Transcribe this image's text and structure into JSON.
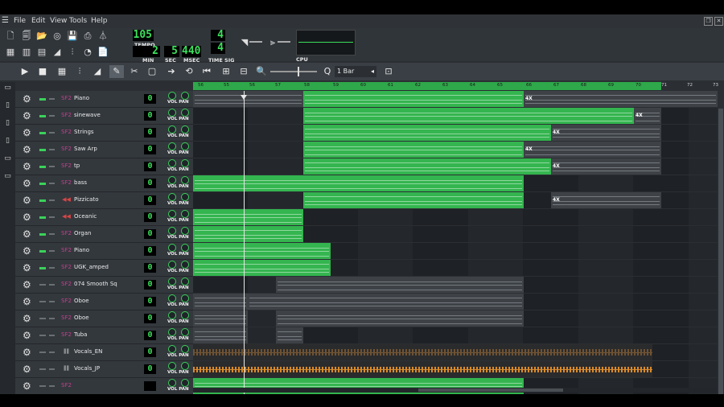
{
  "menubar": {
    "items": [
      "File",
      "Edit",
      "View",
      "Tools",
      "Help"
    ]
  },
  "toolbar": {
    "tempo": {
      "value": "105",
      "label": "TEMPO"
    },
    "time": {
      "min": "2",
      "sec": "5",
      "msec": "440",
      "min_label": "MIN",
      "sec_label": "SEC",
      "msec_label": "MSEC"
    },
    "timesig": {
      "num": "4",
      "den": "4",
      "label": "TIME SIG"
    },
    "cpu_label": "CPU"
  },
  "editor_toolbar": {
    "quantize": "1 Bar"
  },
  "timeline": {
    "ticks": [
      "56",
      "55",
      "56",
      "57",
      "58",
      "59",
      "60",
      "61",
      "62",
      "63",
      "64",
      "65",
      "66",
      "67",
      "68",
      "69",
      "70",
      "71",
      "72",
      "73"
    ]
  },
  "tracks": [
    {
      "name": "Piano",
      "value": "0",
      "icon": "sf2-icon"
    },
    {
      "name": "sinewave",
      "value": "0",
      "icon": "sf2-icon"
    },
    {
      "name": "Strings",
      "value": "0",
      "icon": "sf2-icon"
    },
    {
      "name": "Saw Arp",
      "value": "0",
      "icon": "sf2-icon"
    },
    {
      "name": "tp",
      "value": "0",
      "icon": "sf2-icon"
    },
    {
      "name": "bass",
      "value": "0",
      "icon": "sf2-icon"
    },
    {
      "name": "Pizzicato",
      "value": "0",
      "icon": "plugin-icon"
    },
    {
      "name": "Oceanic",
      "value": "0",
      "icon": "plugin-icon"
    },
    {
      "name": "Organ",
      "value": "0",
      "icon": "sf2-icon"
    },
    {
      "name": "Piano",
      "value": "0",
      "icon": "sf2-icon"
    },
    {
      "name": "UGK_amped",
      "value": "0",
      "icon": "sf2-icon"
    },
    {
      "name": "074 Smooth Sq",
      "value": "0",
      "icon": "sf2-icon"
    },
    {
      "name": "Oboe",
      "value": "0",
      "icon": "sf2-icon"
    },
    {
      "name": "Oboe",
      "value": "0",
      "icon": "sf2-icon"
    },
    {
      "name": "Tuba",
      "value": "0",
      "icon": "sf2-icon"
    },
    {
      "name": "Vocals_EN",
      "value": "0",
      "icon": "waveform-icon"
    },
    {
      "name": "Vocals_JP",
      "value": "0",
      "icon": "waveform-icon"
    },
    {
      "name": "",
      "value": "",
      "icon": "sf2-icon"
    }
  ],
  "labels": {
    "vol": "VOL",
    "pan": "PAN",
    "loop_mark": "4X"
  },
  "colors": {
    "accent": "#34b54f",
    "lcd": "#3ce05c",
    "audio": "#d98a2b"
  }
}
